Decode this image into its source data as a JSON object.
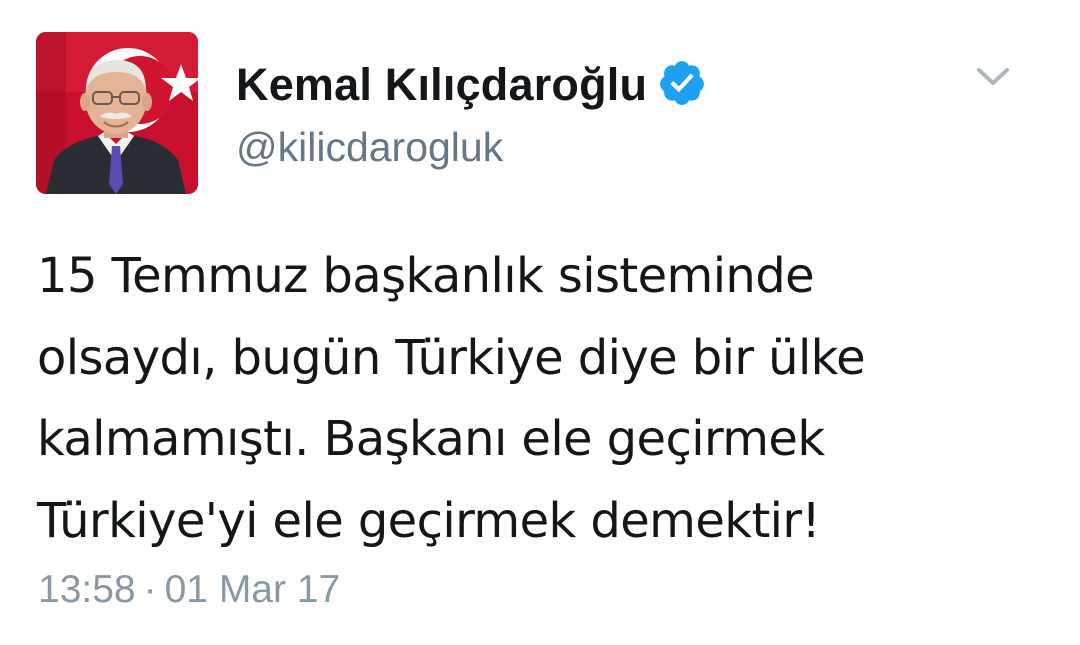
{
  "tweet": {
    "author": {
      "display_name": "Kemal Kılıçdaroğlu",
      "handle": "@kilicdarogluk",
      "verified_icon": "verified-badge-icon",
      "avatar_icon": "profile-photo"
    },
    "menu_icon": "chevron-down-icon",
    "text_lines": [
      "15 Temmuz başkanlık sisteminde",
      "olsaydı, bugün Türkiye diye bir ülke",
      "kalmamıştı. Başkanı ele geçirmek",
      "Türkiye'yi ele geçirmek demektir!"
    ],
    "time": "13:58",
    "separator": "·",
    "date": "01 Mar 17"
  },
  "colors": {
    "text_primary": "#14171a",
    "text_secondary": "#657786",
    "meta": "#8899a6",
    "verified_blue": "#1da1f2",
    "flag_red": "#c8102e"
  }
}
